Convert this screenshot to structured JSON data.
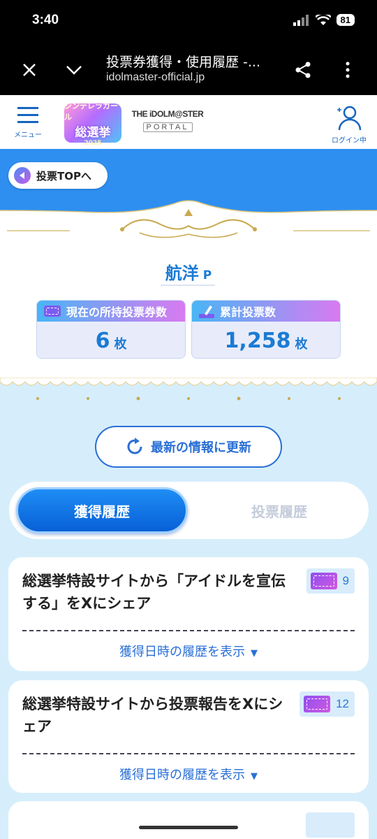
{
  "status_bar": {
    "time": "3:40",
    "battery": "81"
  },
  "browser": {
    "page_title": "投票券獲得・使用履歴 -...",
    "url": "idolmaster-official.jp"
  },
  "header": {
    "menu_label": "メニュー",
    "logo_event": {
      "line1": "シンデレラガール",
      "line2": "総選挙",
      "line3": "2025"
    },
    "logo_portal": {
      "line1": "THE iDOLM@STER",
      "line2": "PORTAL"
    },
    "login_label": "ログイン中"
  },
  "banner": {
    "back_label": "投票TOPへ"
  },
  "profile": {
    "name": "航洋",
    "suffix": "P",
    "stats": [
      {
        "label": "現在の所持投票券数",
        "value": "6",
        "unit": "枚"
      },
      {
        "label": "累計投票数",
        "value": "1,258",
        "unit": "枚"
      }
    ]
  },
  "refresh_label": "最新の情報に更新",
  "tabs": [
    {
      "label": "獲得履歴",
      "active": true
    },
    {
      "label": "投票履歴",
      "active": false
    }
  ],
  "history": [
    {
      "description": "総選挙特設サイトから「アイドルを宣伝する」をXにシェア",
      "count": "9",
      "toggle_label": "獲得日時の履歴を表示"
    },
    {
      "description": "総選挙特設サイトから投票報告をXにシェア",
      "count": "12",
      "toggle_label": "獲得日時の履歴を表示"
    }
  ],
  "colors": {
    "accent": "#2a6fd6",
    "banner_blue": "#2e8ff0",
    "page_bg": "#d6eefb"
  }
}
